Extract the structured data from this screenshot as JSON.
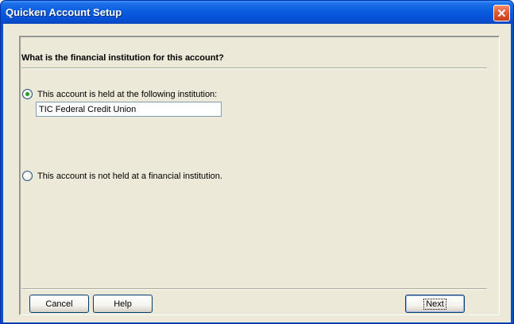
{
  "window": {
    "title": "Quicken Account Setup"
  },
  "dialog": {
    "question": "What is the financial institution for this account?",
    "options": [
      {
        "label": "This account is held at the following institution:",
        "selected": true
      },
      {
        "label": "This account is not held at a financial institution.",
        "selected": false
      }
    ],
    "institution_value": "TIC Federal Credit Union"
  },
  "buttons": {
    "cancel": "Cancel",
    "help": "Help",
    "next": "Next"
  },
  "colors": {
    "titlebar": "#0a5ee0",
    "client_bg": "#ece9d8",
    "close_button": "#e05a36"
  }
}
